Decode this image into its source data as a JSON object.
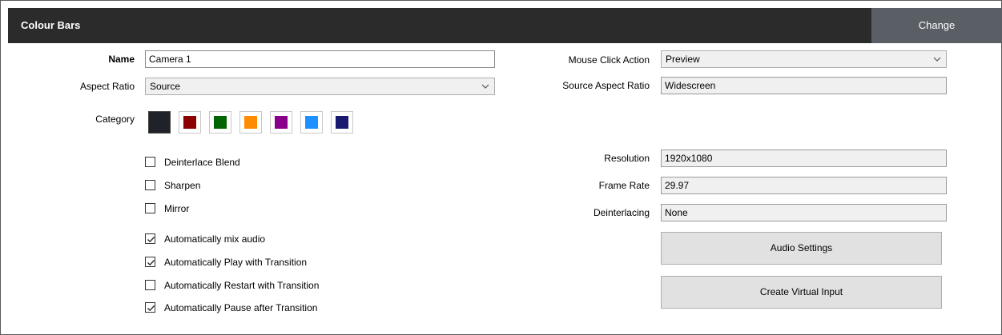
{
  "header": {
    "title": "Colour Bars",
    "change_label": "Change"
  },
  "left": {
    "name_label": "Name",
    "name_value": "Camera 1",
    "aspect_label": "Aspect Ratio",
    "aspect_value": "Source",
    "category_label": "Category",
    "category_colors": [
      "#1f2228",
      "#8b0000",
      "#006400",
      "#ff8c00",
      "#8b008b",
      "#1e90ff",
      "#191970"
    ],
    "category_selected": 0
  },
  "checkboxes": [
    {
      "label": "Deinterlace Blend",
      "checked": false
    },
    {
      "label": "Sharpen",
      "checked": false
    },
    {
      "label": "Mirror",
      "checked": false
    },
    {
      "label": "Automatically mix audio",
      "checked": true
    },
    {
      "label": "Automatically Play with Transition",
      "checked": true
    },
    {
      "label": "Automatically Restart with Transition",
      "checked": false
    },
    {
      "label": "Automatically Pause after Transition",
      "checked": true
    }
  ],
  "right": {
    "mouse_click_label": "Mouse Click Action",
    "mouse_click_value": "Preview",
    "source_aspect_label": "Source Aspect Ratio",
    "source_aspect_value": "Widescreen",
    "resolution_label": "Resolution",
    "resolution_value": "1920x1080",
    "frame_rate_label": "Frame Rate",
    "frame_rate_value": "29.97",
    "deinterlacing_label": "Deinterlacing",
    "deinterlacing_value": "None",
    "audio_settings_label": "Audio Settings",
    "create_virtual_label": "Create Virtual Input"
  }
}
